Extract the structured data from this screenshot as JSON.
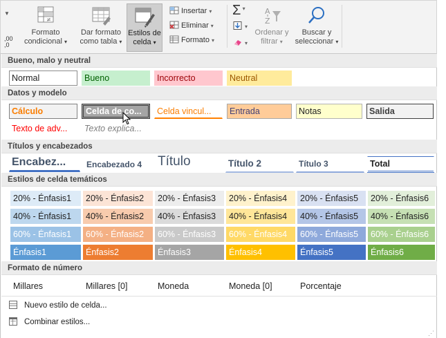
{
  "ribbon": {
    "decimal_glyph": ",00\n,0",
    "formato_condicional": [
      "Formato",
      "condicional"
    ],
    "dar_formato_tabla": [
      "Dar formato",
      "como tabla"
    ],
    "estilos_celda": [
      "Estilos de",
      "celda"
    ],
    "insertar": "Insertar",
    "eliminar": "Eliminar",
    "formato": "Formato",
    "sigma": "Σ",
    "ordenar": [
      "Ordenar y",
      "filtrar"
    ],
    "buscar": [
      "Buscar y",
      "seleccionar"
    ]
  },
  "sections": {
    "bueno_malo": "Bueno, malo y neutral",
    "datos_modelo": "Datos y modelo",
    "titulos": "Títulos y encabezados",
    "tematicos": "Estilos de celda temáticos",
    "numero": "Formato de número"
  },
  "bueno_malo_cells": [
    "Normal",
    "Bueno",
    "Incorrecto",
    "Neutral"
  ],
  "datos_row1": [
    "Cálculo",
    "Celda de co...",
    "Celda vincul...",
    "Entrada",
    "Notas",
    "Salida"
  ],
  "datos_row2": [
    "Texto de adv...",
    "Texto explica..."
  ],
  "titulos_cells": [
    "Encabez...",
    "Encabezado 4",
    "Título",
    "Título 2",
    "Título 3",
    "Total"
  ],
  "enfasis_20": [
    "20% - Énfasis1",
    "20% - Énfasis2",
    "20% - Énfasis3",
    "20% - Énfasis4",
    "20% - Énfasis5",
    "20% - Énfasis6"
  ],
  "enfasis_40": [
    "40% - Énfasis1",
    "40% - Énfasis2",
    "40% - Énfasis3",
    "40% - Énfasis4",
    "40% - Énfasis5",
    "40% - Énfasis6"
  ],
  "enfasis_60": [
    "60% - Énfasis1",
    "60% - Énfasis2",
    "60% - Énfasis3",
    "60% - Énfasis4",
    "60% - Énfasis5",
    "60% - Énfasis6"
  ],
  "enfasis_full": [
    "Énfasis1",
    "Énfasis2",
    "Énfasis3",
    "Énfasis4",
    "Énfasis5",
    "Énfasis6"
  ],
  "numero_cells": [
    "Millares",
    "Millares [0]",
    "Moneda",
    "Moneda [0]",
    "Porcentaje"
  ],
  "footer": {
    "nuevo_estilo": "Nuevo estilo de celda...",
    "combinar": "Combinar estilos..."
  },
  "colors": {
    "bueno_bg": "#c6efce",
    "bueno_fg": "#006100",
    "incorrecto_bg": "#ffc7ce",
    "incorrecto_fg": "#9c0006",
    "neutral_bg": "#ffeb9c",
    "neutral_fg": "#9c5700",
    "calculo_fg": "#fa7d00",
    "entrada_bg": "#ffcc99",
    "notas_bg": "#ffffcc",
    "salida_bg": "#f2f2f2",
    "warning_fg": "#ff0000",
    "heading_fg": "#44546a",
    "enfasis1": "#5b9bd5",
    "enfasis2": "#ed7d31",
    "enfasis3": "#a5a5a5",
    "enfasis4": "#ffc000",
    "enfasis5": "#4472c4",
    "enfasis6": "#70ad47"
  }
}
